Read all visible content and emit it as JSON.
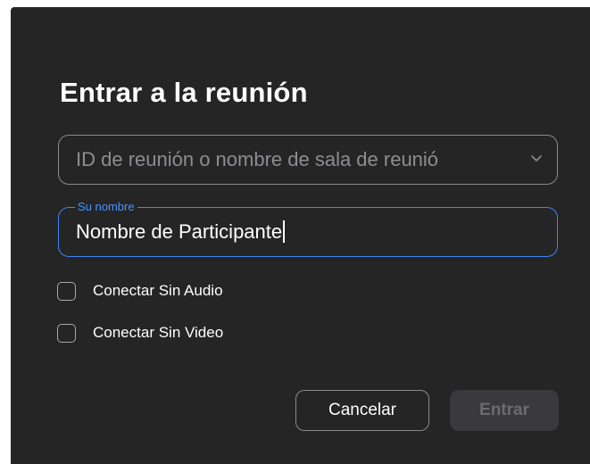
{
  "dialog": {
    "title": "Entrar a la reunión",
    "meeting_id": {
      "placeholder": "ID de reunión o nombre de sala de reunió",
      "value": ""
    },
    "name_field": {
      "label": "Su nombre",
      "value": "Nombre de Participante"
    },
    "options": [
      {
        "label": "Conectar Sin Audio",
        "checked": false
      },
      {
        "label": "Conectar Sin Video",
        "checked": false
      }
    ],
    "buttons": {
      "cancel_label": "Cancelar",
      "enter_label": "Entrar",
      "enter_enabled": false
    }
  },
  "colors": {
    "background": "#252526",
    "focus_accent": "#3d86f7",
    "disabled_button": "#3a3a3c"
  },
  "icons": {
    "dropdown": "chevron-down-icon"
  }
}
